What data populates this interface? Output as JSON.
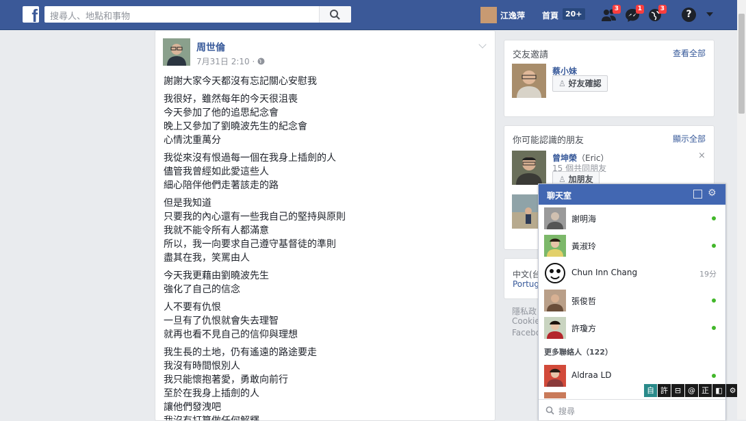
{
  "header": {
    "search_placeholder": "搜尋人、地點和事物",
    "user_name": "江逸萍",
    "home_label": "首頁",
    "home_badge": "20+",
    "friend_requests_count": "3",
    "messages_count": "1",
    "notifications_count": "3",
    "help_icon": "?",
    "brand_color": "#3b5998"
  },
  "post": {
    "author": "周世倫",
    "timestamp": "7月31日 2:10",
    "privacy_separator": "·",
    "paragraphs": [
      [
        "謝謝大家今天都沒有忘記關心安慰我"
      ],
      [
        "我很好，雖然每年的今天很沮喪",
        "今天參加了他的追思紀念會",
        "晚上又參加了劉曉波先生的紀念會",
        "心情沈重萬分"
      ],
      [
        "我從來沒有恨過每一個在我身上插劍的人",
        "儘管我曾經如此愛這些人",
        "細心陪伴他們走著該走的路"
      ],
      [
        "但是我知道",
        "只要我的內心還有一些我自己的堅持與原則",
        "我就不能令所有人都滿意",
        "所以，我一向要求自己遵守基督徒的準則",
        "盡其在我，笑罵由人"
      ],
      [
        "今天我更藉由劉曉波先生",
        "強化了自己的信念"
      ],
      [
        "人不要有仇恨",
        "一旦有了仇恨就會失去理智",
        "就再也看不見自己的信仰與理想"
      ],
      [
        "我生長的土地，仍有遙遠的路途要走",
        "我沒有時間恨別人",
        "我只能懷抱著愛，勇敢向前行",
        "至於在我身上插劍的人",
        "讓他們發洩吧",
        "我沒有打算做任何解釋"
      ]
    ]
  },
  "friend_requests": {
    "title": "交友邀請",
    "see_all": "查看全部",
    "request_name": "蔡小妹",
    "confirm_label": "好友確認"
  },
  "people_you_may_know": {
    "title": "你可能認識的朋友",
    "see_all": "顯示全部",
    "person_name": "曾坤榮",
    "person_alias": "（Eric）",
    "mutual_friends": "15 個共同朋友",
    "add_friend_label": "加朋友",
    "close_icon": "×"
  },
  "language_card": {
    "line1": "中文(台",
    "line2": "Portug"
  },
  "footer_links": {
    "line1": "隱私政",
    "line2": "Cookie",
    "line3": "Facebo"
  },
  "chat": {
    "title": "聊天室",
    "contacts": [
      {
        "name": "謝明海",
        "status": "online"
      },
      {
        "name": "黃淑玲",
        "status": "online"
      },
      {
        "name": "Chun Inn Chang",
        "status": "19分"
      },
      {
        "name": "張俊哲",
        "status": "online"
      },
      {
        "name": "許瓊方",
        "status": "online"
      }
    ],
    "more_contacts_label": "更多聯絡人（122）",
    "more_contact": {
      "name": "Aldraa LD",
      "status": "online"
    },
    "search_placeholder": "搜尋",
    "online_color": "#42b72a"
  },
  "ime_toolbar": [
    "自",
    "許",
    "⊟",
    "@",
    "正",
    "◧",
    "⚙"
  ]
}
